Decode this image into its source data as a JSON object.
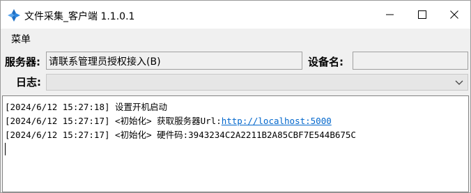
{
  "window": {
    "title": "文件采集_客户端 1.1.0.1"
  },
  "menu": {
    "items": [
      "菜单"
    ]
  },
  "form": {
    "server_label": "服务器:",
    "server_value": "请联系管理员授权接入(B)",
    "device_label": "设备名:",
    "device_value": "",
    "log_label": "日志:",
    "log_selected": ""
  },
  "log": {
    "lines": [
      {
        "prefix": "[2024/6/12 15:27:18] 设置开机启动",
        "link": ""
      },
      {
        "prefix": "[2024/6/12 15:27:17] <初始化> 获取服务器Url:",
        "link": "http://localhost:5000"
      },
      {
        "prefix": "[2024/6/12 15:27:17] <初始化> 硬件码:3943234C2A2211B2A85CBF7E544B675C",
        "link": ""
      }
    ]
  },
  "icons": {
    "app": "app-logo-icon",
    "minimize": "minimize-icon",
    "maximize": "maximize-icon",
    "close": "close-icon",
    "dropdown": "chevron-down-icon"
  },
  "colors": {
    "link": "#0066cc",
    "titlebar": "#ffffff",
    "window_bg": "#f0f0f0"
  }
}
